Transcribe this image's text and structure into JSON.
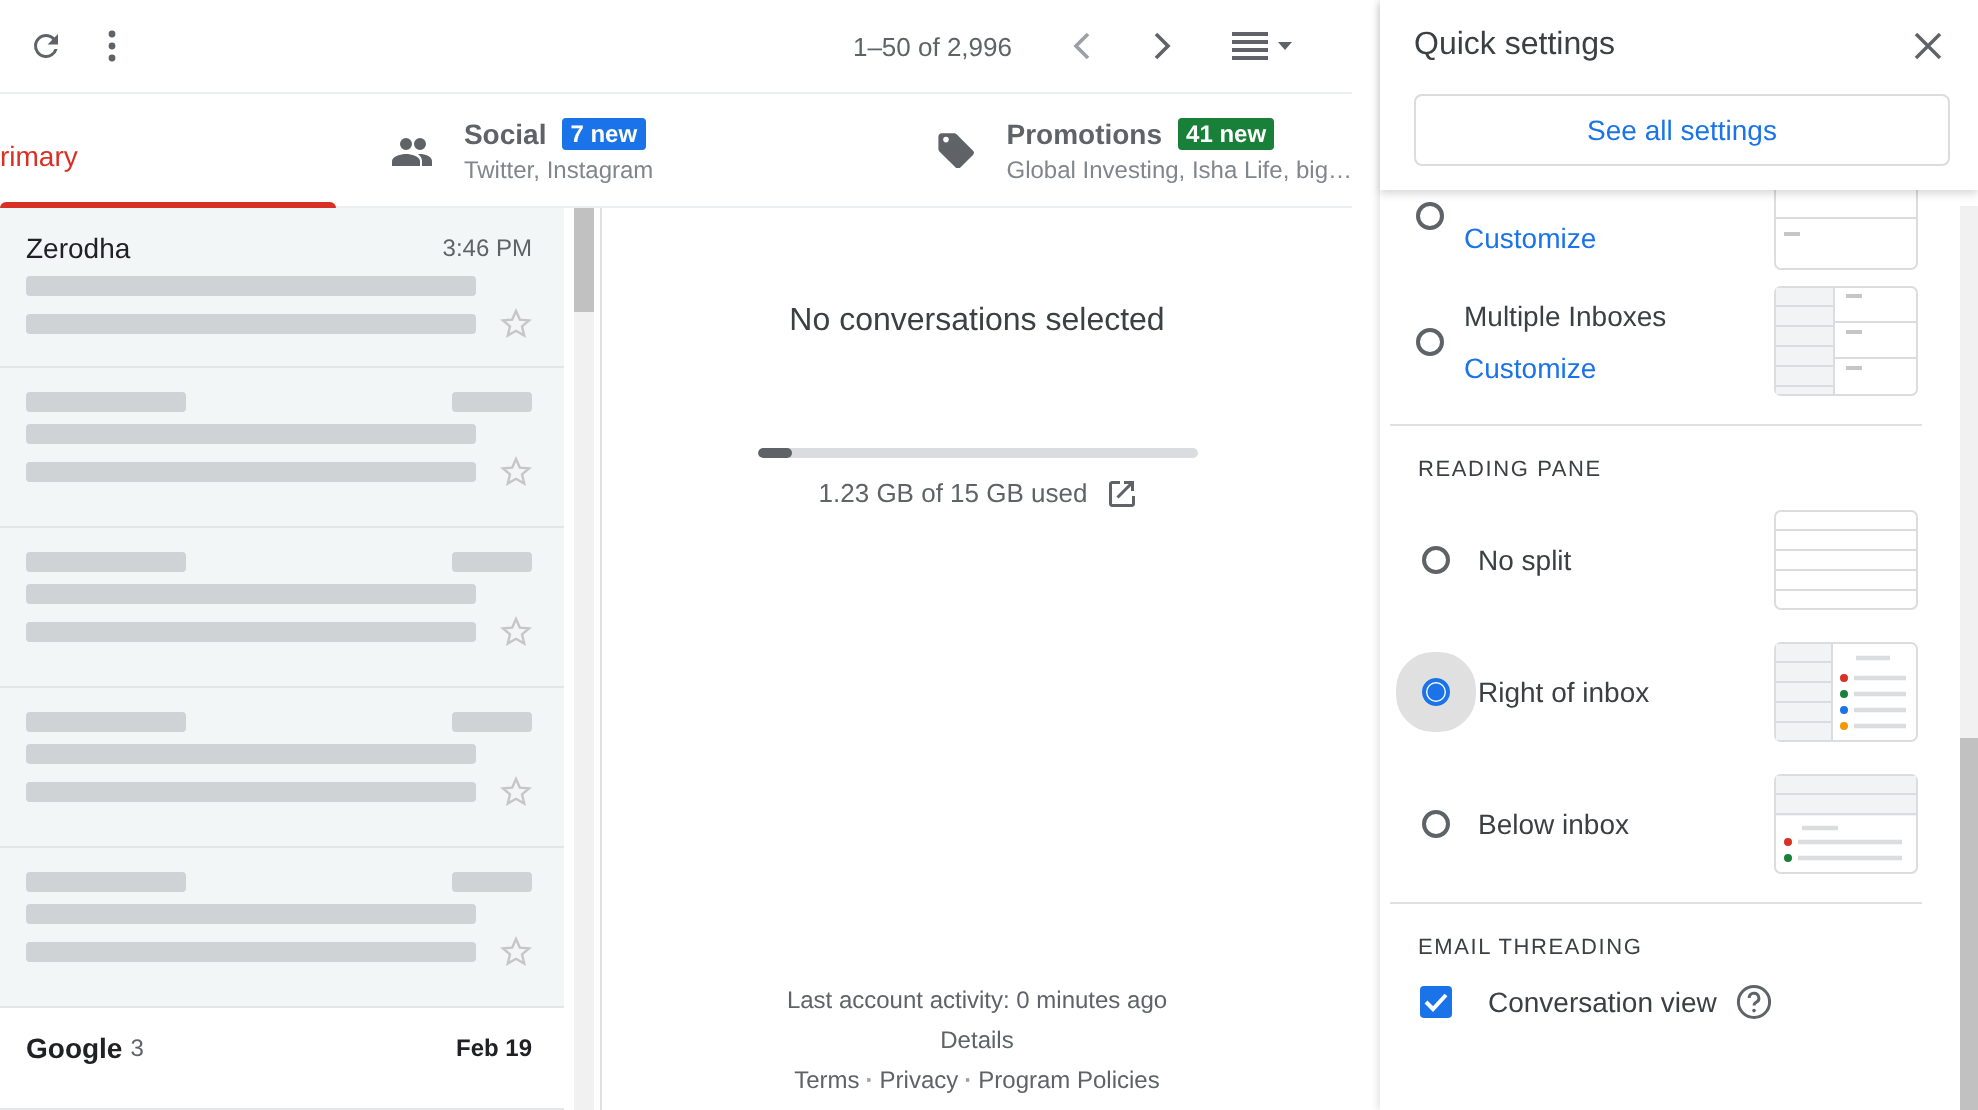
{
  "toolbar": {
    "pagination": "1–50 of 2,996"
  },
  "tabs": [
    {
      "label": "rimary",
      "selected": true
    },
    {
      "label": "Social",
      "badge": "7 new",
      "color": "#1a73e8",
      "subtitle": "Twitter, Instagram",
      "selected": false,
      "kind": "people"
    },
    {
      "label": "Promotions",
      "badge": "41 new",
      "color": "#188038",
      "subtitle": "Global Investing, Isha Life, big…",
      "selected": false,
      "kind": "tag"
    }
  ],
  "emails": [
    {
      "sender": "Zerodha",
      "time": "3:46 PM",
      "unread": false
    },
    {
      "unread": false
    },
    {
      "unread": false
    },
    {
      "unread": false
    },
    {
      "unread": false
    },
    {
      "sender": "Google",
      "count": "3",
      "time": "Feb 19",
      "unread": true
    }
  ],
  "reading_pane": {
    "message": "No conversations selected",
    "storage": {
      "level": 0.08,
      "reading": "1.23 GB of 15 GB used"
    },
    "activity": "Last account activity: 0 minutes ago",
    "details": "Details",
    "footer_links": [
      {
        "kind": "link",
        "text": "Terms"
      },
      {
        "kind": "separator",
        "text": "·"
      },
      {
        "kind": "link",
        "text": "Privacy"
      },
      {
        "kind": "separator",
        "text": "·"
      },
      {
        "kind": "link",
        "text": "Program Policies"
      }
    ]
  },
  "quick_settings": {
    "title": "Quick settings",
    "button": "See all settings",
    "inbox_types": [
      {
        "link": "Customize",
        "selected": false,
        "kind": "priority"
      },
      {
        "label": "Multiple Inboxes",
        "link": "Customize",
        "selected": false,
        "kind": "multiple"
      }
    ],
    "reading_pane": {
      "heading": "READING PANE",
      "options": [
        {
          "label": "No split",
          "selected": false,
          "kind": "none"
        },
        {
          "label": "Right of inbox",
          "selected": true,
          "kind": "right"
        },
        {
          "label": "Below inbox",
          "selected": false,
          "kind": "below"
        }
      ]
    },
    "email_threading": {
      "heading": "EMAIL THREADING",
      "label": "Conversation view",
      "checked": true
    }
  }
}
